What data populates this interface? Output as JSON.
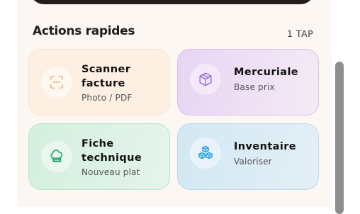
{
  "section": {
    "title": "Actions rapides",
    "meta": "1 TAP"
  },
  "cards": [
    {
      "id": "scanner",
      "title": "Scanner facture",
      "subtitle": "Photo / PDF",
      "icon": "scan-icon",
      "accent": "#f2b27a"
    },
    {
      "id": "mercuriale",
      "title": "Mercuriale",
      "subtitle": "Base prix",
      "icon": "cube-icon",
      "accent": "#9b6fd6"
    },
    {
      "id": "fiche",
      "title": "Fiche technique",
      "subtitle": "Nouveau plat",
      "icon": "chef-hat-icon",
      "accent": "#1fa56a"
    },
    {
      "id": "inventaire",
      "title": "Inventaire",
      "subtitle": "Valoriser",
      "icon": "boxes-icon",
      "accent": "#2aa6e0"
    }
  ]
}
